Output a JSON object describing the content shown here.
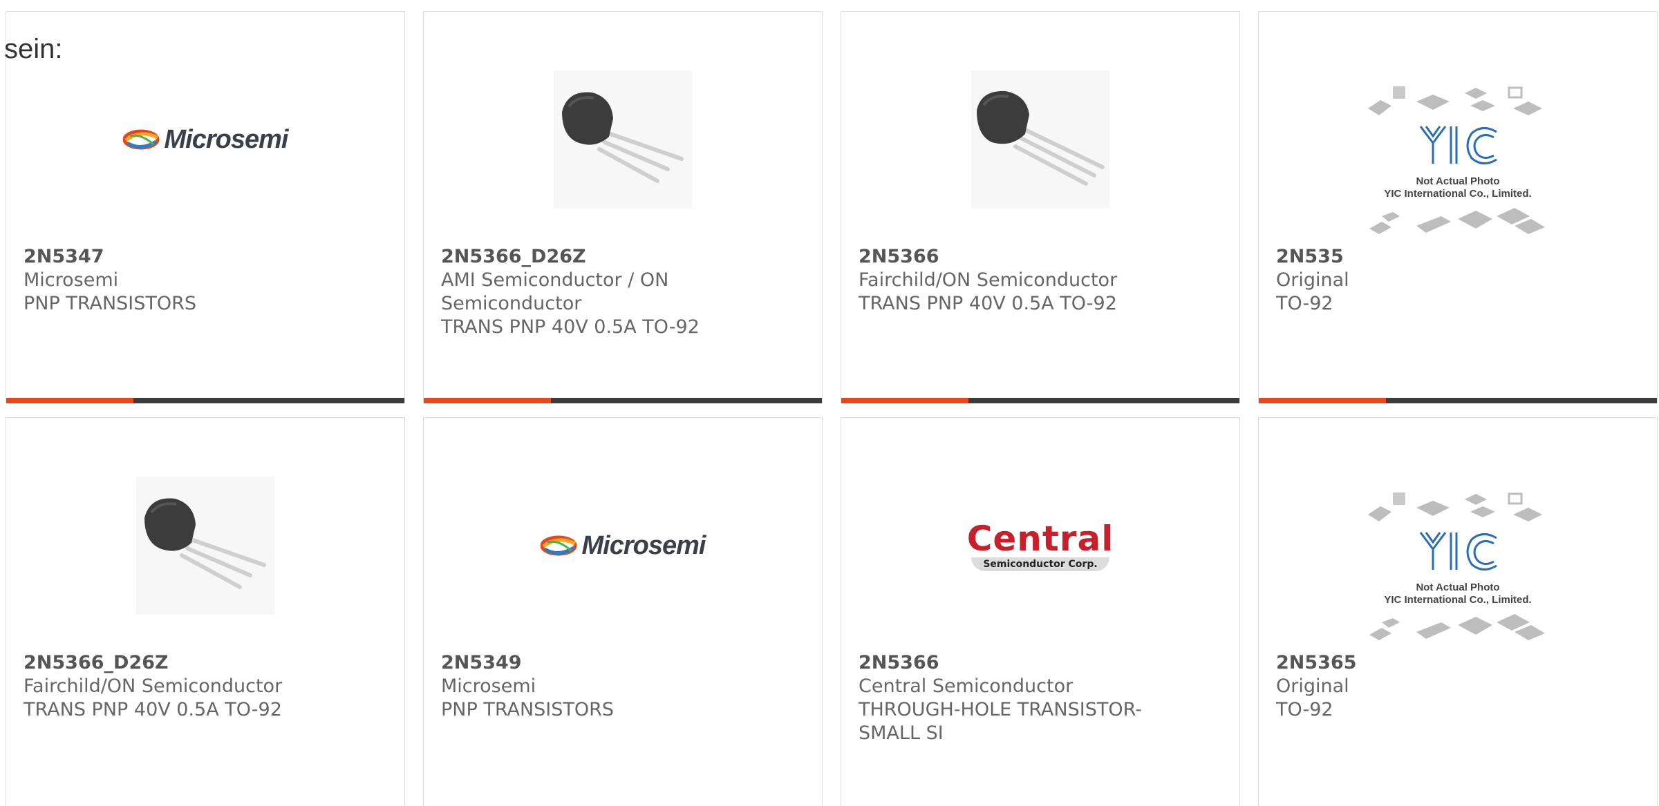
{
  "intro": "sein:",
  "products": [
    {
      "part": "2N5347",
      "maker": "Microsemi",
      "desc": "PNP TRANSISTORS",
      "image": "microsemi-logo"
    },
    {
      "part": "2N5366_D26Z",
      "maker": "AMI Semiconductor / ON Semiconductor",
      "desc": "TRANS PNP 40V 0.5A TO-92",
      "image": "to92-transistor"
    },
    {
      "part": "2N5366",
      "maker": "Fairchild/ON Semiconductor",
      "desc": "TRANS PNP 40V 0.5A TO-92",
      "image": "to92-transistor"
    },
    {
      "part": "2N535",
      "maker": "Original",
      "desc": "TO-92",
      "image": "yic-placeholder"
    },
    {
      "part": "2N5366_D26Z",
      "maker": "Fairchild/ON Semiconductor",
      "desc": "TRANS PNP 40V 0.5A TO-92",
      "image": "to92-transistor"
    },
    {
      "part": "2N5349",
      "maker": "Microsemi",
      "desc": "PNP TRANSISTORS",
      "image": "microsemi-logo"
    },
    {
      "part": "2N5366",
      "maker": "Central Semiconductor",
      "desc": "THROUGH-HOLE TRANSISTOR-SMALL SI",
      "image": "central-logo"
    },
    {
      "part": "2N5365",
      "maker": "Original",
      "desc": "TO-92",
      "image": "yic-placeholder"
    }
  ],
  "logos": {
    "microsemi": "Microsemi",
    "central_big": "Central",
    "central_small": "Semiconductor Corp.",
    "yic_mark": "YIC",
    "yic_line1": "Not Actual Photo",
    "yic_line2": "YIC International Co., Limited."
  },
  "colors": {
    "accent": "#e8471c",
    "bar": "#3b3b3b",
    "central_red": "#c8202b",
    "yic_blue": "#2a6db5"
  }
}
